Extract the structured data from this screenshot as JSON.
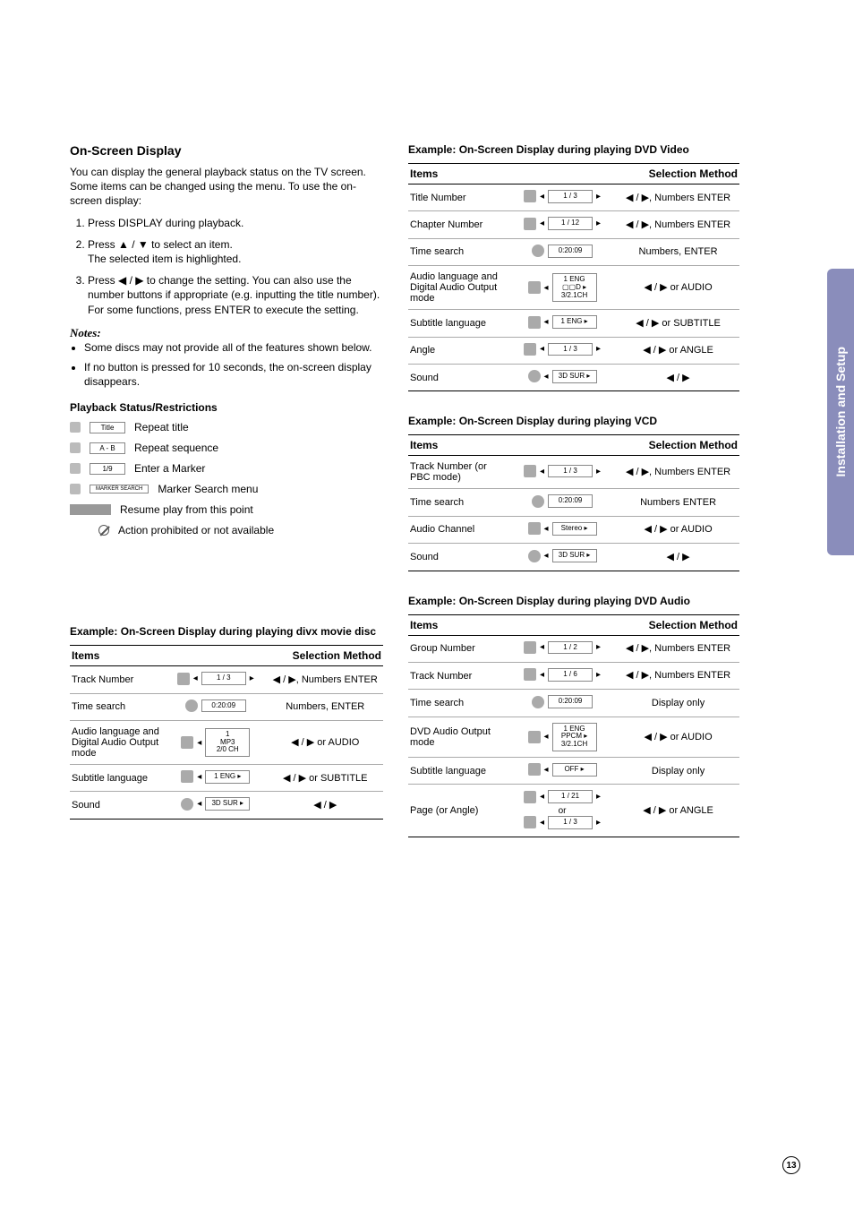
{
  "side_tab_label": "Installation and Setup",
  "page_number": "13",
  "left": {
    "title": "On-Screen Display",
    "intro": "You can display the general playback status on the TV screen. Some items can be changed using the menu. To use the on-screen display:",
    "steps": {
      "s1": "Press DISPLAY during playback.",
      "s2a": "Press ▲ / ▼ to select an item.",
      "s2b": "The selected item is highlighted.",
      "s3": "Press ◀ / ▶ to change the setting. You can also use the number buttons if appropriate (e.g. inputting the title number). For some functions, press ENTER to execute the setting."
    },
    "notes_head": "Notes:",
    "note1": "Some discs may not provide all of the features shown below.",
    "note2": "If no button is pressed for 10 seconds, the on-screen display disappears.",
    "status_head": "Playback Status/Restrictions",
    "status": {
      "r1_chip": "Title",
      "r1_text": "Repeat title",
      "r2_chip": "A - B",
      "r2_text": "Repeat sequence",
      "r3_chip": "1/9",
      "r3_text": "Enter a Marker",
      "r4_chip": "MARKER SEARCH",
      "r4_text": "Marker Search menu",
      "r5_text": "Resume play from this point",
      "r6_text": "Action prohibited or not available"
    }
  },
  "tables": {
    "divx": {
      "title": "Example: On-Screen Display during playing divx movie disc",
      "items_head": "Items",
      "sel_head": "Selection Method",
      "r1_name": "Track Number",
      "r1_chip": "1 / 3",
      "r1_sel": "◀ / ▶, Numbers ENTER",
      "r2_name": "Time search",
      "r2_chip": "0:20:09",
      "r2_sel": "Numbers, ENTER",
      "r3_name": "Audio language and Digital Audio Output mode",
      "r3_chipa": "1",
      "r3_chipb": "MP3",
      "r3_chipc": "2/0 CH",
      "r3_sel": "◀ / ▶ or AUDIO",
      "r4_name": "Subtitle language",
      "r4_chip": "1 ENG ▸",
      "r4_sel": "◀ / ▶ or SUBTITLE",
      "r5_name": "Sound",
      "r5_chip": "3D SUR ▸",
      "r5_sel": "◀ / ▶"
    },
    "dvdv": {
      "title": "Example: On-Screen Display during playing DVD Video",
      "items_head": "Items",
      "sel_head": "Selection Method",
      "r1_name": "Title Number",
      "r1_chip": "1 / 3",
      "r1_sel": "◀ / ▶, Numbers ENTER",
      "r2_name": "Chapter Number",
      "r2_chip": "1 / 12",
      "r2_sel": "◀ / ▶, Numbers ENTER",
      "r3_name": "Time search",
      "r3_chip": "0:20:09",
      "r3_sel": "Numbers, ENTER",
      "r4_name": "Audio language and Digital Audio Output mode",
      "r4_chipa": "1 ENG",
      "r4_chipb": "▢▢D ▸",
      "r4_chipc": "3/2.1CH",
      "r4_sel": "◀ / ▶ or AUDIO",
      "r5_name": "Subtitle language",
      "r5_chip": "1 ENG ▸",
      "r5_sel": "◀ / ▶ or SUBTITLE",
      "r6_name": "Angle",
      "r6_chip": "1 / 3",
      "r6_sel": "◀ / ▶ or ANGLE",
      "r7_name": "Sound",
      "r7_chip": "3D SUR ▸",
      "r7_sel": "◀ / ▶"
    },
    "vcd": {
      "title": "Example: On-Screen Display during playing VCD",
      "items_head": "Items",
      "sel_head": "Selection Method",
      "r1_name": "Track Number (or PBC mode)",
      "r1_chip": "1 / 3",
      "r1_sel": "◀ / ▶, Numbers ENTER",
      "r2_name": "Time search",
      "r2_chip": "0:20:09",
      "r2_sel": "Numbers ENTER",
      "r3_name": "Audio Channel",
      "r3_chip": "Stereo ▸",
      "r3_sel": "◀ / ▶ or AUDIO",
      "r4_name": "Sound",
      "r4_chip": "3D SUR ▸",
      "r4_sel": "◀ / ▶"
    },
    "dvda": {
      "title": "Example: On-Screen Display during playing DVD Audio",
      "items_head": "Items",
      "sel_head": "Selection Method",
      "r1_name": "Group Number",
      "r1_chip": "1 / 2",
      "r1_sel": "◀ / ▶, Numbers ENTER",
      "r2_name": "Track Number",
      "r2_chip": "1 / 6",
      "r2_sel": "◀ / ▶, Numbers ENTER",
      "r3_name": "Time search",
      "r3_chip": "0:20:09",
      "r3_sel": "Display only",
      "r4_name": "DVD Audio Output mode",
      "r4_chipa": "1 ENG",
      "r4_chipb": "PPCM ▸",
      "r4_chipc": "3/2.1CH",
      "r4_sel": "◀ / ▶ or AUDIO",
      "r5_name": "Subtitle language",
      "r5_chip": "OFF ▸",
      "r5_sel": "Display only",
      "r6_name": "Page (or Angle)",
      "r6_chip": "1 / 21",
      "r6_or": "or",
      "r6_chip2": "1 / 3",
      "r6_sel": "◀ / ▶ or ANGLE"
    }
  }
}
